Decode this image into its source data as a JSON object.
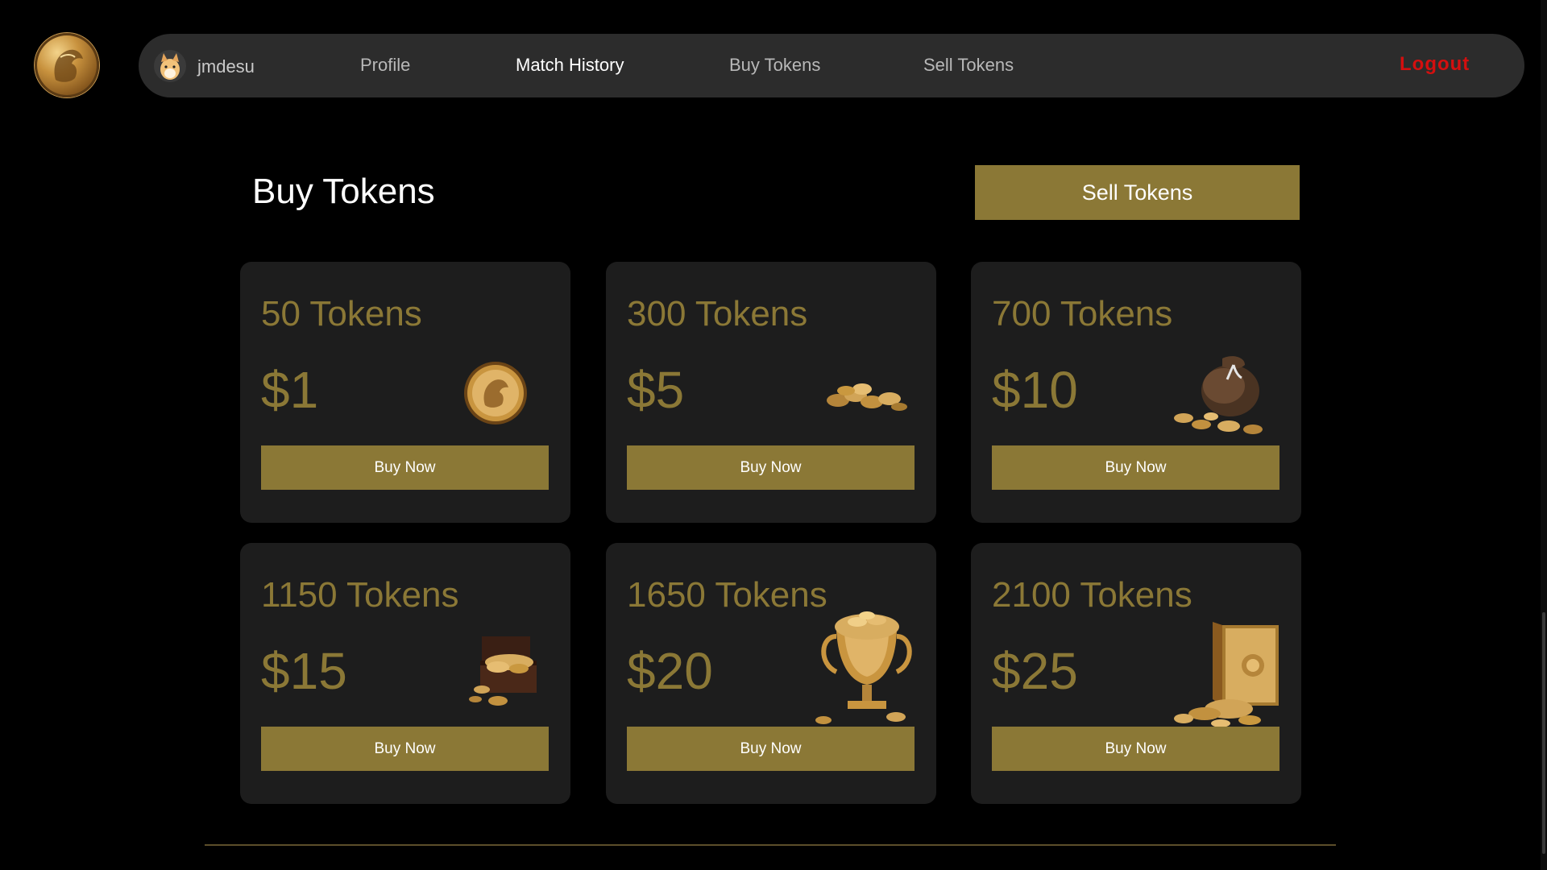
{
  "nav": {
    "username": "jmdesu",
    "links": [
      "Profile",
      "Match History",
      "Buy Tokens",
      "Sell Tokens"
    ],
    "logout": "Logout"
  },
  "page": {
    "title": "Buy Tokens",
    "sell_button": "Sell Tokens"
  },
  "packages": [
    {
      "tokens": "50 Tokens",
      "price": "$1",
      "button": "Buy Now",
      "icon": "single-coin-icon"
    },
    {
      "tokens": "300 Tokens",
      "price": "$5",
      "button": "Buy Now",
      "icon": "coin-pile-icon"
    },
    {
      "tokens": "700 Tokens",
      "price": "$10",
      "button": "Buy Now",
      "icon": "coin-sack-icon"
    },
    {
      "tokens": "1150 Tokens",
      "price": "$15",
      "button": "Buy Now",
      "icon": "treasure-chest-icon"
    },
    {
      "tokens": "1650 Tokens",
      "price": "$20",
      "button": "Buy Now",
      "icon": "trophy-cup-icon"
    },
    {
      "tokens": "2100 Tokens",
      "price": "$25",
      "button": "Buy Now",
      "icon": "safe-vault-icon"
    }
  ],
  "colors": {
    "accent_gold": "#8b7836",
    "card_bg": "#1d1d1d",
    "nav_bg": "#2c2c2c",
    "logout_red": "#d40f0f"
  }
}
